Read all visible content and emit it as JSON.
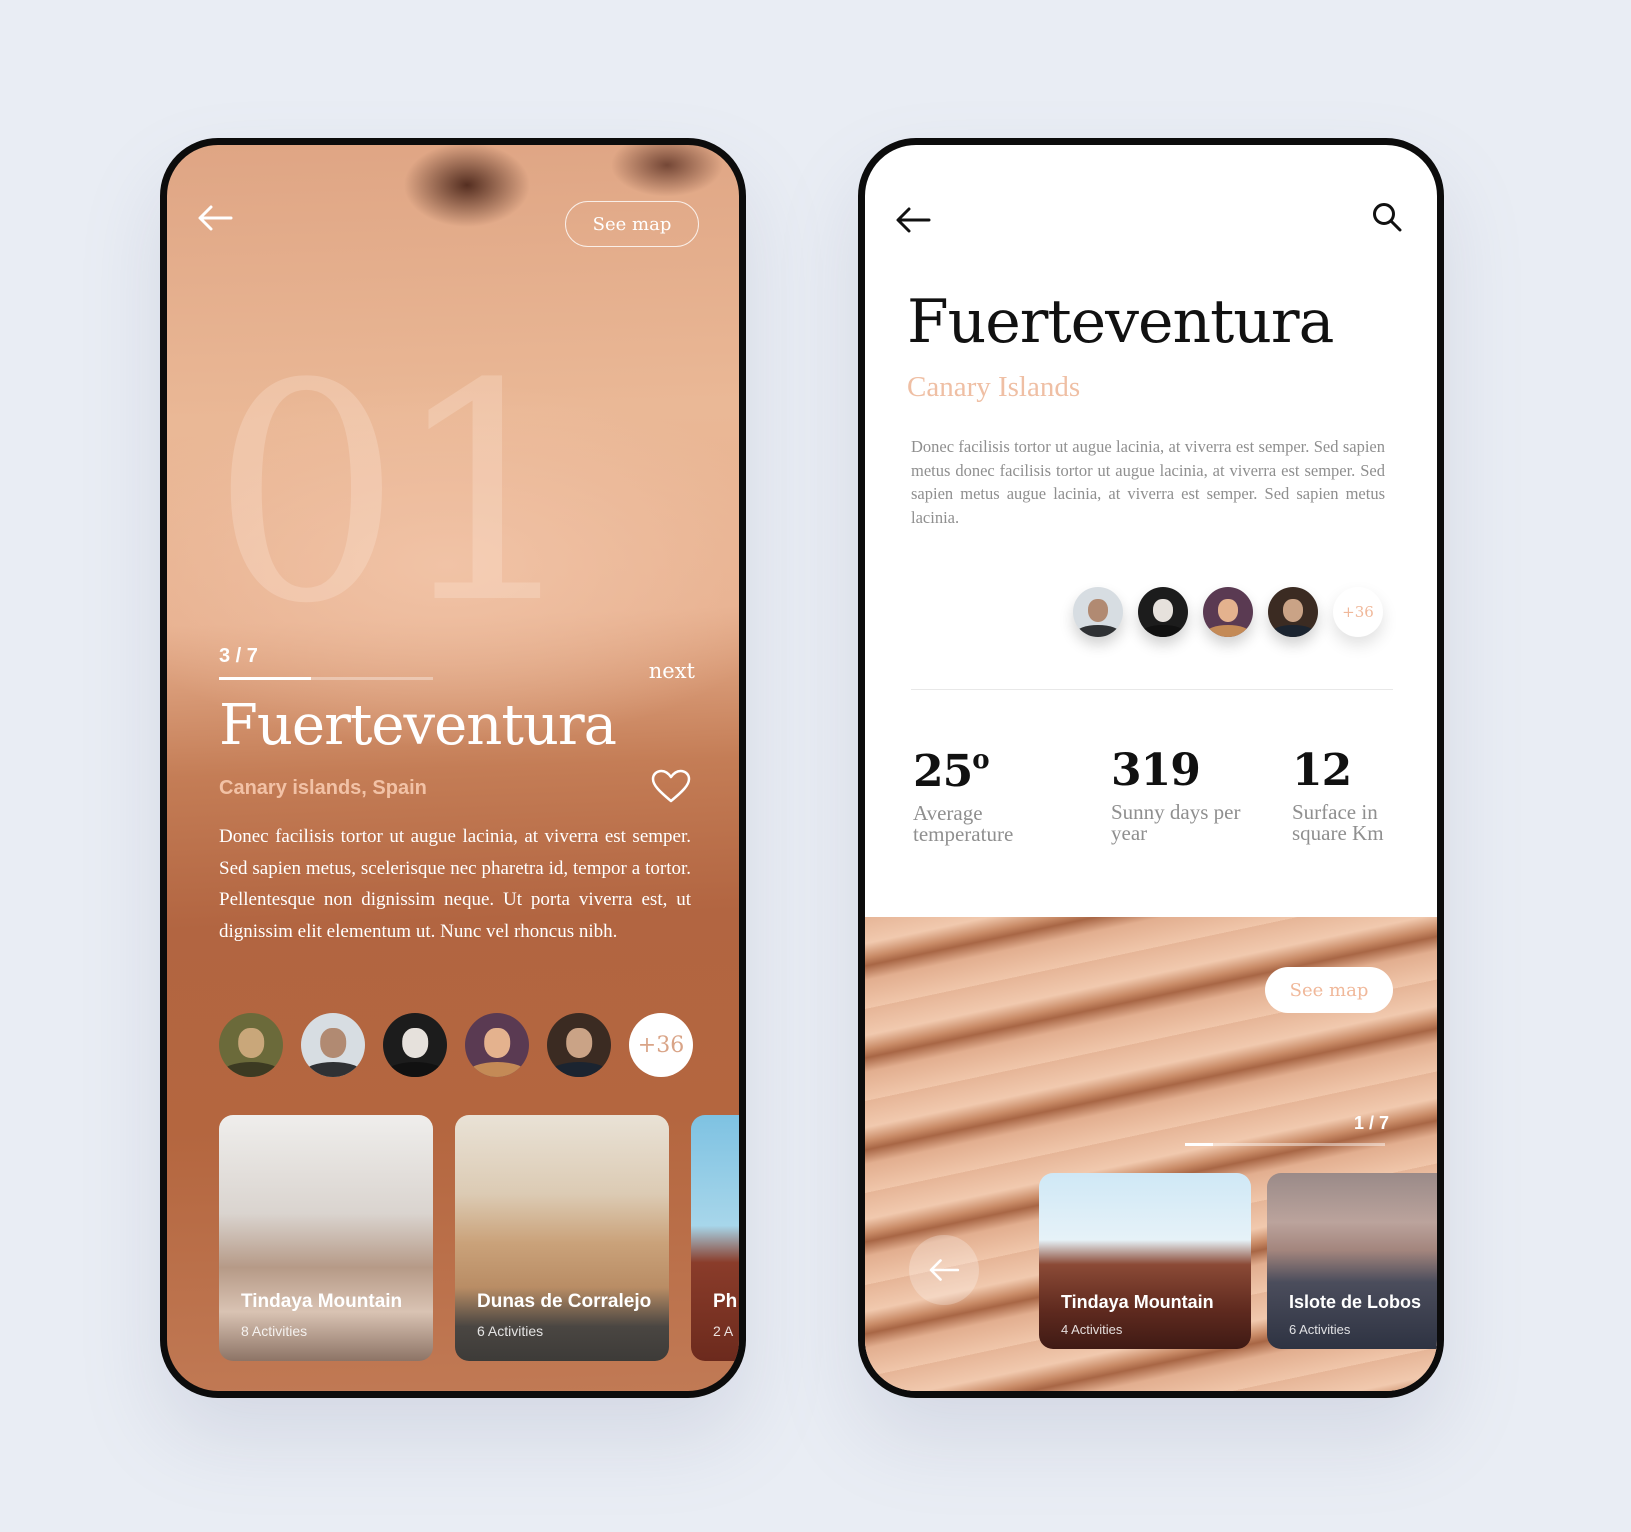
{
  "left_screen": {
    "see_map_label": "See map",
    "big_number": "01",
    "counter": "3 / 7",
    "progress": 0.43,
    "next_label": "next",
    "title": "Fuerteventura",
    "subtitle": "Canary islands, Spain",
    "description": "Donec facilisis tortor ut augue lacinia, at viverra est semper. Sed sapien metus, scelerisque nec pharetra id, tempor a tortor. Pellentesque non dignissim neque. Ut porta viverra est, ut dignissim elit elementum ut. Nunc vel rhoncus nibh.",
    "more_people": "+36",
    "cards": [
      {
        "title": "Tindaya Mountain",
        "subtitle": "8 Activities"
      },
      {
        "title": "Dunas de Corralejo",
        "subtitle": "6 Activities"
      },
      {
        "title": "Ph",
        "subtitle": "2 A"
      }
    ]
  },
  "right_screen": {
    "title": "Fuerteventura",
    "subtitle": "Canary Islands",
    "description": "Donec facilisis tortor ut augue lacinia, at viverra est semper. Sed sapien metus donec facilisis tortor ut augue lacinia, at viverra est semper. Sed sapien metus augue lacinia, at viverra est semper. Sed sapien metus lacinia.",
    "more_people": "+36",
    "stats": [
      {
        "value": "25",
        "suffix": "o",
        "label": "Average temperature"
      },
      {
        "value": "319",
        "suffix": "",
        "label": "Sunny days per year"
      },
      {
        "value": "12",
        "suffix": "",
        "label": "Surface in square Km"
      }
    ],
    "see_map_label": "See map",
    "counter": "1 / 7",
    "progress": 0.14,
    "cards": [
      {
        "title": "Tindaya Mountain",
        "subtitle": "4 Activities"
      },
      {
        "title": "Islote de Lobos",
        "subtitle": "6 Activities"
      }
    ]
  },
  "colors": {
    "page_background": "#e9edf4",
    "accent_peach": "#efbfa4",
    "desert_orange": "#c47d56",
    "text_dark": "#111111"
  }
}
